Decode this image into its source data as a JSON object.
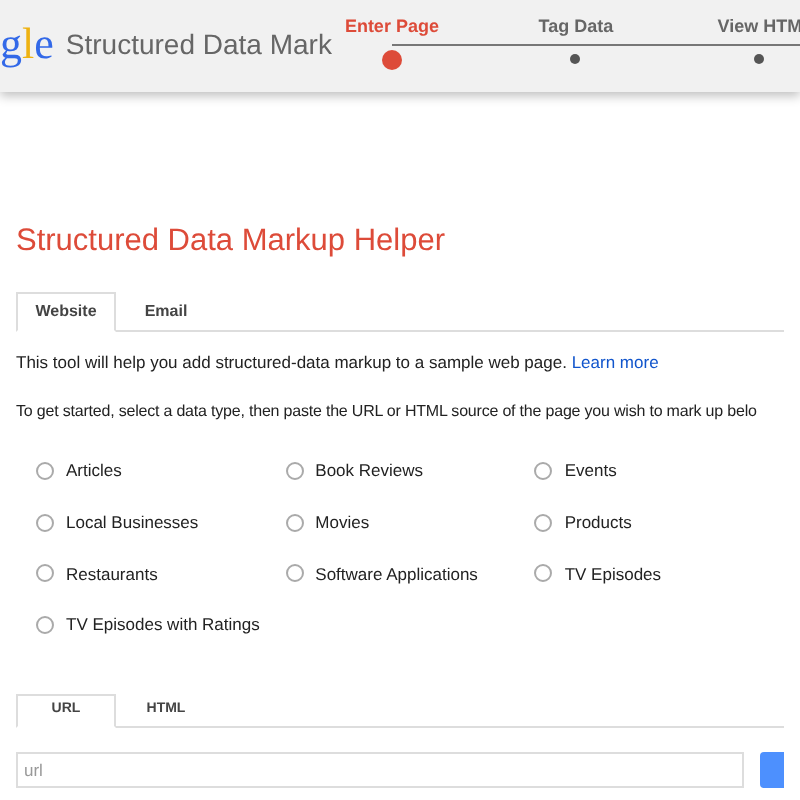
{
  "header": {
    "logo": "gle",
    "title": "Structured Data Mark"
  },
  "steps": [
    {
      "label": "Enter Page",
      "selected": true
    },
    {
      "label": "Tag Data",
      "selected": false
    },
    {
      "label": "View HTM",
      "selected": false
    }
  ],
  "page_title": "Structured Data Markup Helper",
  "tabs": [
    {
      "label": "Website",
      "selected": true
    },
    {
      "label": "Email",
      "selected": false
    }
  ],
  "intro": "This tool will help you add structured-data markup to a sample web page.",
  "learn_more": "Learn more",
  "instruction": "To get started, select a data type, then paste the URL or HTML source of the page you wish to mark up belo",
  "data_types": [
    {
      "label": "Articles",
      "selected": false
    },
    {
      "label": "Book Reviews",
      "selected": false
    },
    {
      "label": "Events",
      "selected": false
    },
    {
      "label": "Local Businesses",
      "selected": false
    },
    {
      "label": "Movies",
      "selected": false
    },
    {
      "label": "Products",
      "selected": false
    },
    {
      "label": "Restaurants",
      "selected": false
    },
    {
      "label": "Software Applications",
      "selected": false
    },
    {
      "label": "TV Episodes",
      "selected": false
    },
    {
      "label": "TV Episodes with Ratings",
      "selected": false
    }
  ],
  "source_tabs": [
    {
      "label": "URL",
      "selected": true
    },
    {
      "label": "HTML",
      "selected": false
    }
  ],
  "url_field": {
    "placeholder": "url"
  }
}
